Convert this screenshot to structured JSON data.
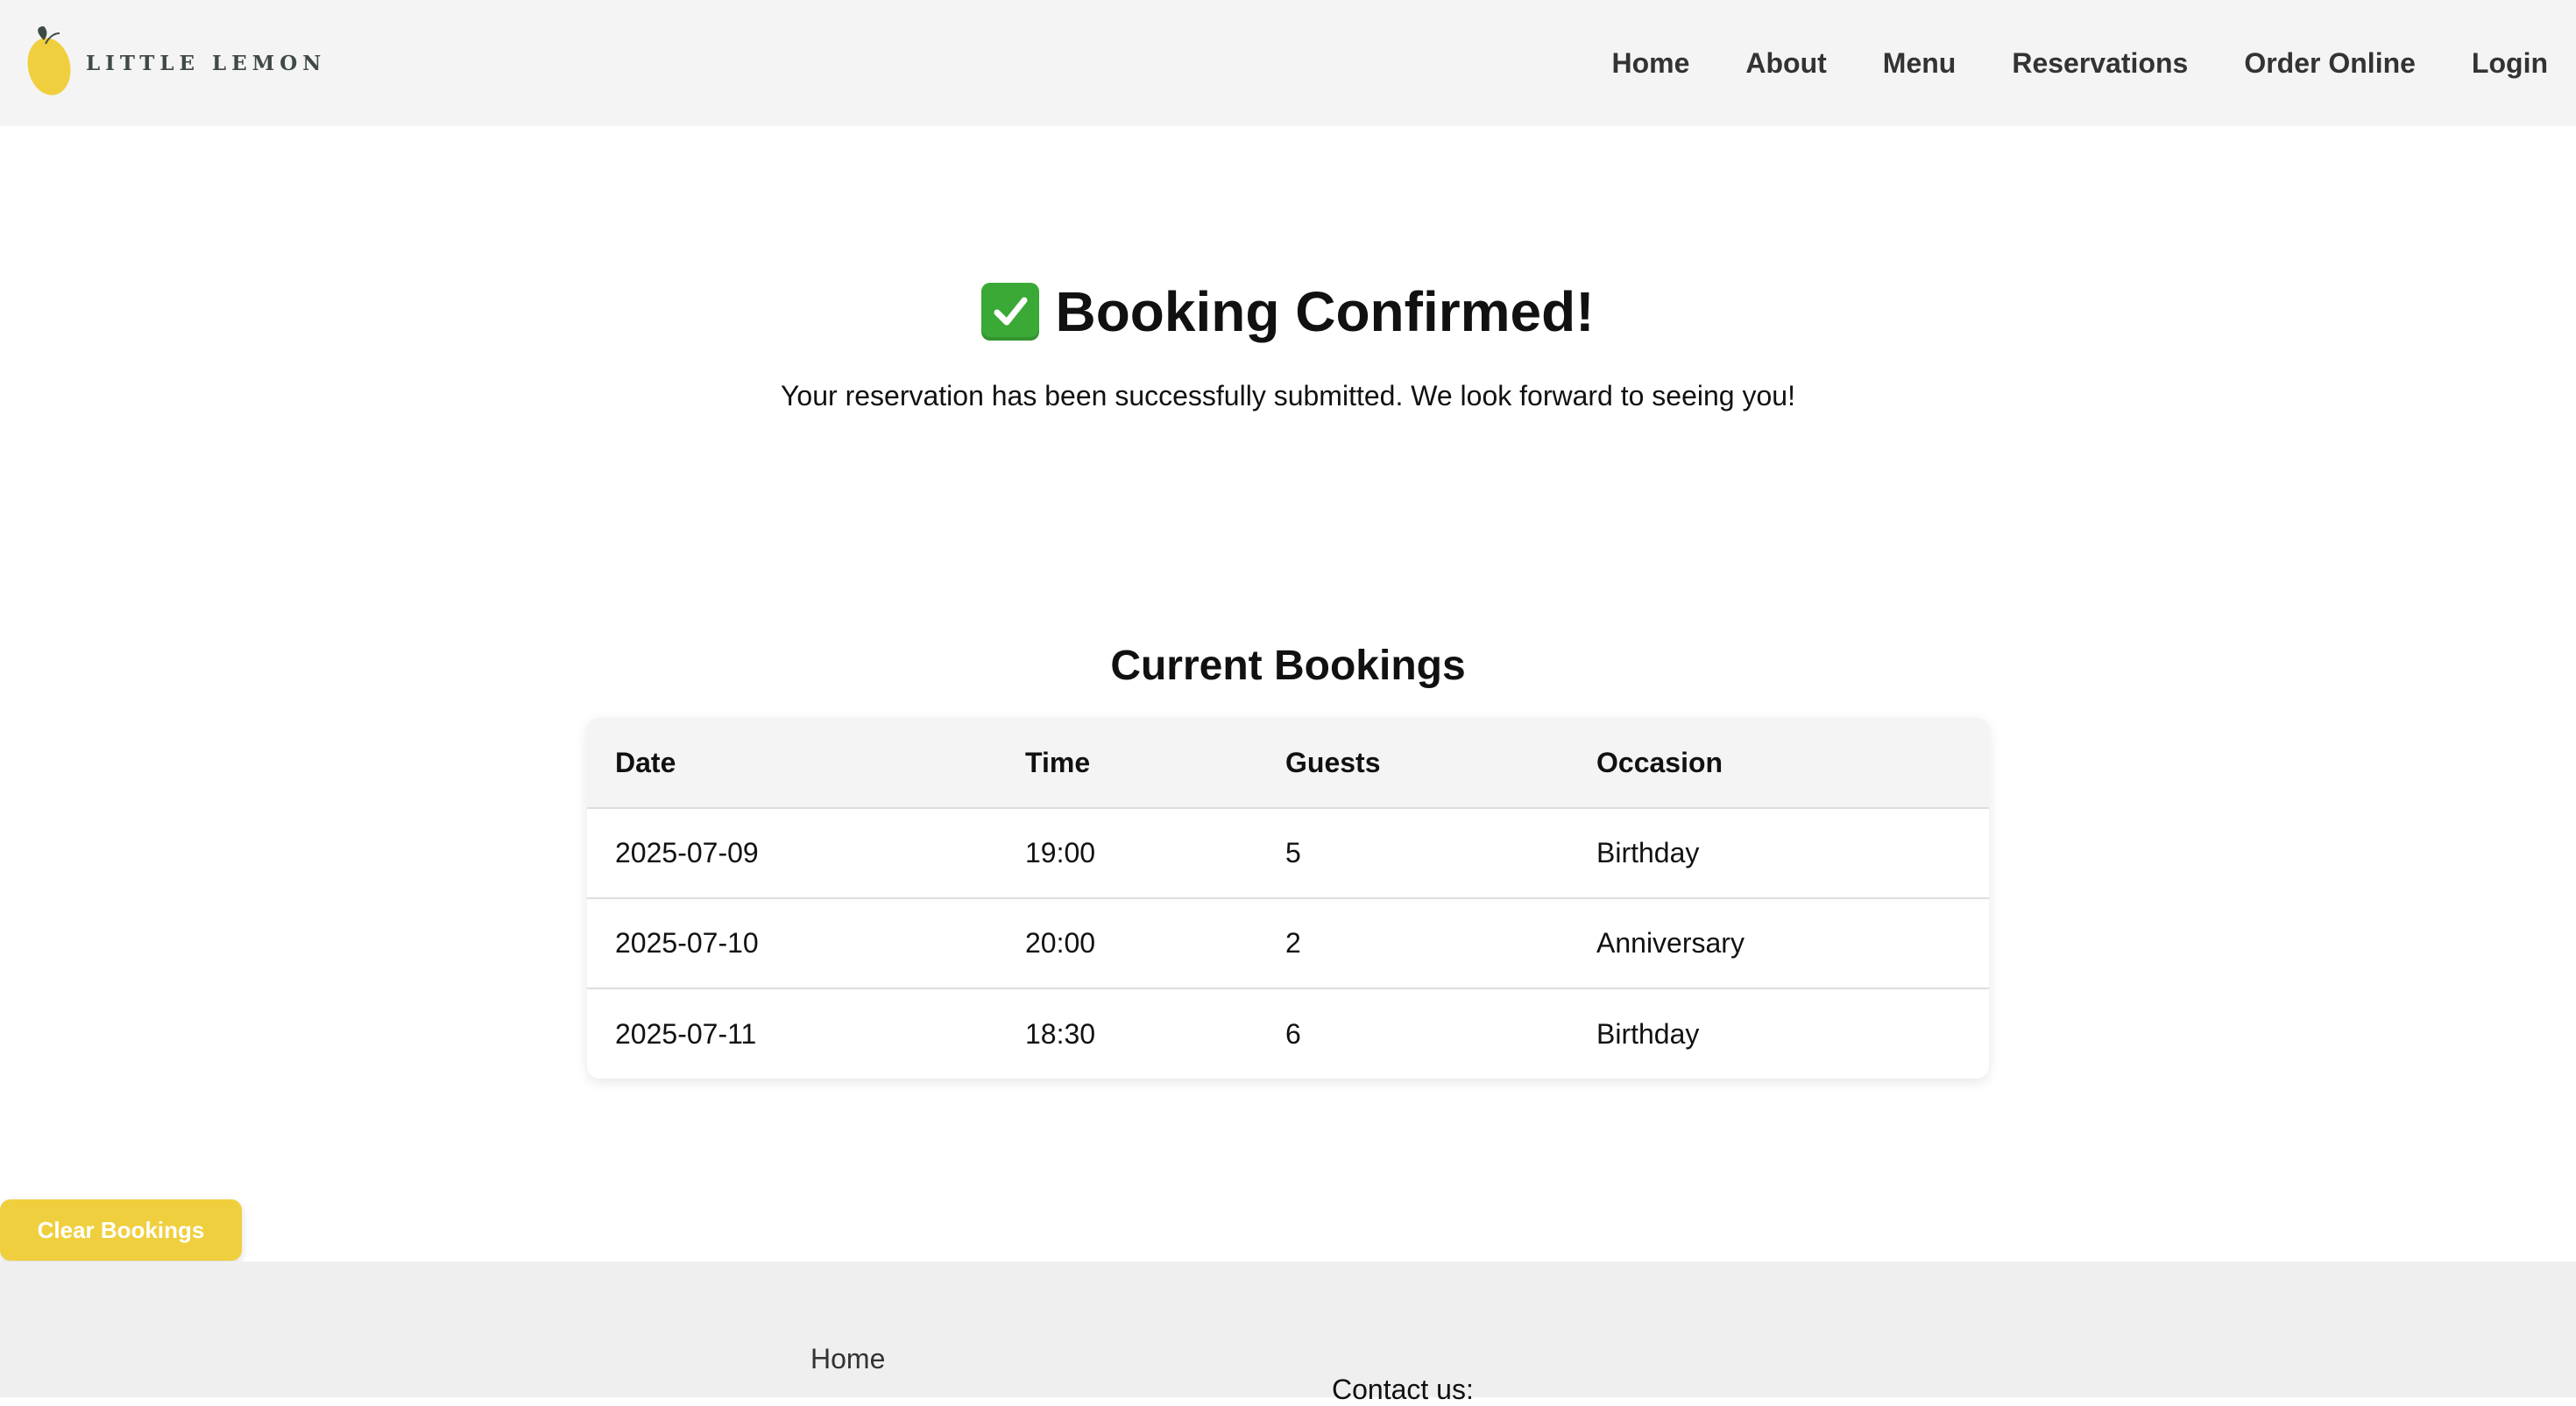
{
  "brand": {
    "logo_text": "LITTLE LEMON",
    "logo_icon": "lemon-icon",
    "accent_color": "#f0cf3e"
  },
  "nav": {
    "items": [
      {
        "label": "Home"
      },
      {
        "label": "About"
      },
      {
        "label": "Menu"
      },
      {
        "label": "Reservations"
      },
      {
        "label": "Order Online"
      },
      {
        "label": "Login"
      }
    ]
  },
  "confirmation": {
    "icon": "check-mark-icon",
    "title": "Booking Confirmed!",
    "message": "Your reservation has been successfully submitted. We look forward to seeing you!"
  },
  "bookings": {
    "title": "Current Bookings",
    "columns": [
      "Date",
      "Time",
      "Guests",
      "Occasion"
    ],
    "rows": [
      {
        "date": "2025-07-09",
        "time": "19:00",
        "guests": "5",
        "occasion": "Birthday"
      },
      {
        "date": "2025-07-10",
        "time": "20:00",
        "guests": "2",
        "occasion": "Anniversary"
      },
      {
        "date": "2025-07-11",
        "time": "18:30",
        "guests": "6",
        "occasion": "Birthday"
      }
    ]
  },
  "actions": {
    "clear_label": "Clear Bookings"
  },
  "footer": {
    "home_link": "Home",
    "contact_label": "Contact us:"
  }
}
